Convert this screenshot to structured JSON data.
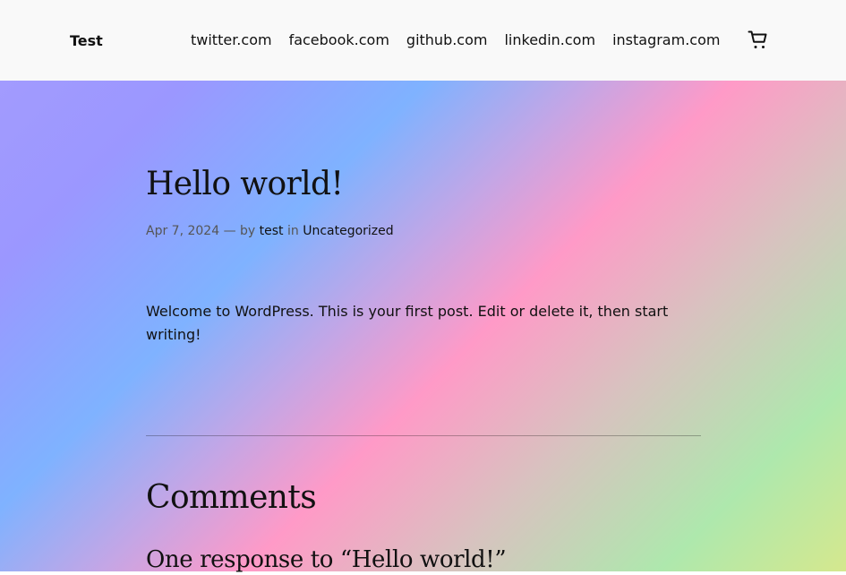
{
  "header": {
    "site_title": "Test",
    "nav": [
      {
        "label": "twitter.com"
      },
      {
        "label": "facebook.com"
      },
      {
        "label": "github.com"
      },
      {
        "label": "linkedin.com"
      },
      {
        "label": "instagram.com"
      }
    ],
    "cart_icon": "cart-icon"
  },
  "post": {
    "title": "Hello world!",
    "date": "Apr 7, 2024",
    "separator": "—",
    "by": "by",
    "author": "test",
    "in": "in",
    "category": "Uncategorized",
    "excerpt": "Welcome to WordPress. This is your first post. Edit or delete it, then start writing!"
  },
  "comments": {
    "heading": "Comments",
    "response_heading": "One response to “Hello world!”"
  },
  "colors": {
    "header_bg": "#f9f9f9",
    "text": "#111111",
    "gradient": [
      "#a29bfe",
      "#7fb2ff",
      "#ff9ac7",
      "#aee8ad",
      "#d5e88e"
    ]
  }
}
